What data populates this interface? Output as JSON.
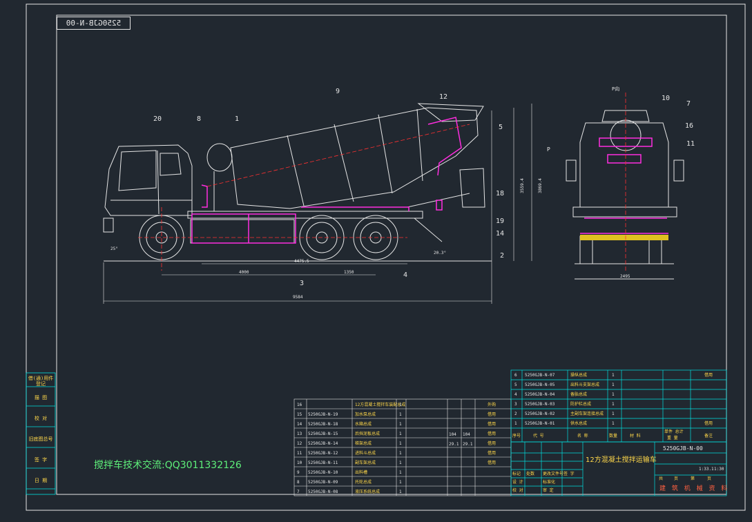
{
  "drawing_code": "5250GJB-N-00",
  "view_label": "P向",
  "arrow_label": "P",
  "callouts": {
    "c20": "20",
    "c8": "8",
    "c1": "1",
    "c9": "9",
    "c12": "12",
    "c5": "5",
    "c18": "18",
    "c19": "19",
    "c14": "14",
    "c2": "2",
    "c4": "4",
    "c3": "3",
    "c10": "10",
    "c7": "7",
    "c16": "16",
    "c11": "11"
  },
  "dimensions": {
    "d4000": "4000",
    "d1350": "1350",
    "d9584": "9584",
    "d2495": "2495",
    "d3559": "3559.4",
    "d3869": "3869.4",
    "d4475": "4475.5",
    "a25": "25°",
    "a20": "20.3°"
  },
  "side_table": [
    "借(通)用件登记",
    "描 图",
    "校 对",
    "旧底图总号",
    "签 字",
    "日 期"
  ],
  "parts_left": [
    {
      "no": "16",
      "code": "",
      "name": "12方混凝土搅拌车装配总成",
      "qty": "1",
      "w1": "",
      "w2": "",
      "note": "外购"
    },
    {
      "no": "15",
      "code": "5250GJB-N-19",
      "name": "加水泵总成",
      "qty": "1",
      "w1": "",
      "w2": "",
      "note": "借用"
    },
    {
      "no": "14",
      "code": "5250GJB-N-18",
      "name": "水箱总成",
      "qty": "1",
      "w1": "",
      "w2": "",
      "note": "借用"
    },
    {
      "no": "13",
      "code": "5250GJB-N-15",
      "name": "后挡泥板总成",
      "qty": "1",
      "w1": "",
      "w2": "",
      "note": "借用"
    },
    {
      "no": "12",
      "code": "5250GJB-N-14",
      "name": "梯架总成",
      "qty": "1",
      "w1": "104",
      "w2": "104",
      "note": "借用"
    },
    {
      "no": "11",
      "code": "5250GJB-N-12",
      "name": "进料斗总成",
      "qty": "1",
      "w1": "29.1",
      "w2": "29.1",
      "note": "借用"
    },
    {
      "no": "10",
      "code": "5250GJB-N-11",
      "name": "副车架总成",
      "qty": "1",
      "w1": "",
      "w2": "",
      "note": "借用"
    },
    {
      "no": "9",
      "code": "5250GJB-N-10",
      "name": "出料槽",
      "qty": "1",
      "w1": "",
      "w2": "",
      "note": ""
    },
    {
      "no": "8",
      "code": "5250GJB-N-09",
      "name": "托轮总成",
      "qty": "1",
      "w1": "",
      "w2": "",
      "note": ""
    },
    {
      "no": "7",
      "code": "5250GJB-N-08",
      "name": "液压系统总成",
      "qty": "1",
      "w1": "",
      "w2": "",
      "note": ""
    }
  ],
  "parts_right": [
    {
      "no": "6",
      "code": "5250GJB-N-07",
      "name": "操纵总成",
      "qty": "1",
      "note": "借用"
    },
    {
      "no": "5",
      "code": "5250GJB-N-05",
      "name": "出料斗支架总成",
      "qty": "1",
      "note": ""
    },
    {
      "no": "4",
      "code": "5250GJB-N-04",
      "name": "备胎总成",
      "qty": "1",
      "note": ""
    },
    {
      "no": "3",
      "code": "5250GJB-N-03",
      "name": "防护栏总成",
      "qty": "1",
      "note": ""
    },
    {
      "no": "2",
      "code": "5250GJB-N-02",
      "name": "主副车架连接总成",
      "qty": "1",
      "note": ""
    },
    {
      "no": "1",
      "code": "5250GJB-N-01",
      "name": "供水总成",
      "qty": "1",
      "note": "借用"
    }
  ],
  "header_row": {
    "no": "序号",
    "code": "代 号",
    "name": "名 称",
    "qty": "数量",
    "mat": "材 料",
    "w": "单件 总计",
    "wu": "重 量",
    "note": "备注"
  },
  "title_block": {
    "code": "5250GJB-N-00",
    "project": "12方混凝土搅拌运输车",
    "scale": "1:33.1",
    "ratio": "1:30",
    "company": "建 筑 机 械 资 料",
    "labels": [
      "标记",
      "处数",
      "更改文件号",
      "签 字",
      "设 计",
      "标准化",
      "校 对",
      "审 定",
      "审 核",
      "日 期",
      "工艺审查",
      "批 准",
      "共",
      "页",
      "第",
      "页"
    ]
  },
  "watermark": "搅拌车技术交流:QQ3011332126",
  "colors": {
    "background": "#212830",
    "lines": "#e6e6e6",
    "accent": "#ff2de0",
    "red": "#ff3030",
    "cyan": "#00e0e0",
    "yellow": "#ffd84a"
  }
}
